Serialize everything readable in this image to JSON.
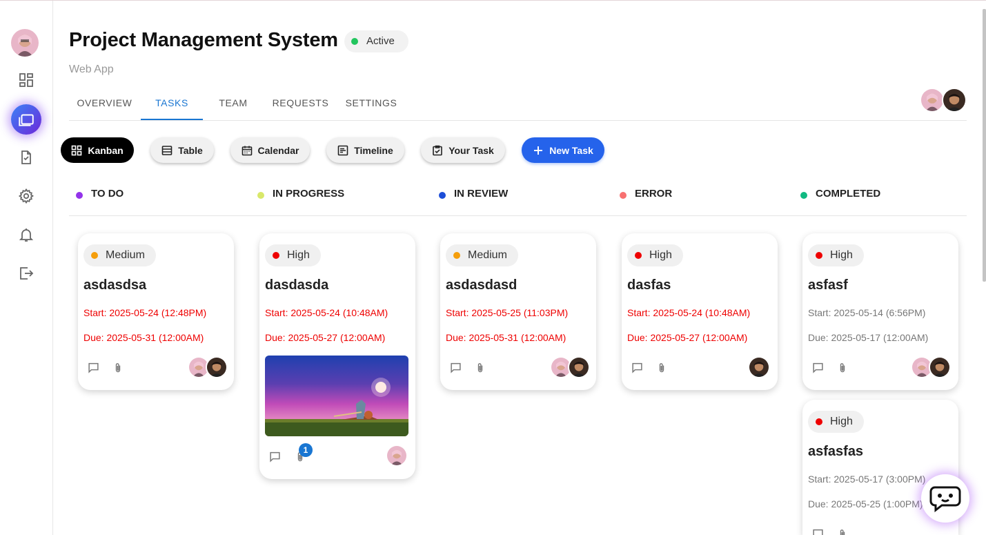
{
  "project": {
    "title": "Project Management System",
    "status": "Active",
    "subtitle": "Web App"
  },
  "tabs": [
    {
      "label": "OVERVIEW",
      "active": false
    },
    {
      "label": "TASKS",
      "active": true
    },
    {
      "label": "TEAM",
      "active": false
    },
    {
      "label": "REQUESTS",
      "active": false
    },
    {
      "label": "SETTINGS",
      "active": false
    }
  ],
  "sidebar": {
    "items": [
      {
        "icon": "dashboard-icon",
        "active": false
      },
      {
        "icon": "folder-icon",
        "active": true
      },
      {
        "icon": "task-check-icon",
        "active": false
      },
      {
        "icon": "gear-icon",
        "active": false
      },
      {
        "icon": "bell-icon",
        "active": false
      },
      {
        "icon": "logout-icon",
        "active": false
      }
    ]
  },
  "views": {
    "kanban": "Kanban",
    "table": "Table",
    "calendar": "Calendar",
    "timeline": "Timeline",
    "your_task": "Your Task",
    "new_task": "New Task"
  },
  "columns": [
    {
      "label": "TO DO",
      "color": "#9333ea"
    },
    {
      "label": "IN PROGRESS",
      "color": "#d9e86a"
    },
    {
      "label": "IN REVIEW",
      "color": "#1d4ed8"
    },
    {
      "label": "ERROR",
      "color": "#f87171"
    },
    {
      "label": "COMPLETED",
      "color": "#10b981"
    }
  ],
  "cards": [
    {
      "priority": "Medium",
      "priority_color": "#f59e0b",
      "title": "asdasdsa",
      "start": "Start: 2025-05-24 (12:48PM)",
      "due": "Due: 2025-05-31 (12:00AM)",
      "overdue": true
    },
    {
      "priority": "High",
      "priority_color": "#e00",
      "title": "dasdasda",
      "start": "Start: 2025-05-24 (10:48AM)",
      "due": "Due: 2025-05-27 (12:00AM)",
      "overdue": true,
      "attachments": "1"
    },
    {
      "priority": "Medium",
      "priority_color": "#f59e0b",
      "title": "asdasdasd",
      "start": "Start: 2025-05-25 (11:03PM)",
      "due": "Due: 2025-05-31 (12:00AM)",
      "overdue": true
    },
    {
      "priority": "High",
      "priority_color": "#e00",
      "title": "dasfas",
      "start": "Start: 2025-05-24 (10:48AM)",
      "due": "Due: 2025-05-27 (12:00AM)",
      "overdue": true
    },
    {
      "priority": "High",
      "priority_color": "#e00",
      "title": "asfasf",
      "start": "Start: 2025-05-14 (6:56PM)",
      "due": "Due: 2025-05-17 (12:00AM)",
      "overdue": false
    },
    {
      "priority": "High",
      "priority_color": "#e00",
      "title": "asfasfas",
      "start": "Start: 2025-05-17 (3:00PM)",
      "due": "Due: 2025-05-25 (1:00PM)",
      "overdue": false
    }
  ],
  "colors": {
    "accent": "#1976d2",
    "primary_button": "#2563eb",
    "overdue_text": "#e00"
  }
}
